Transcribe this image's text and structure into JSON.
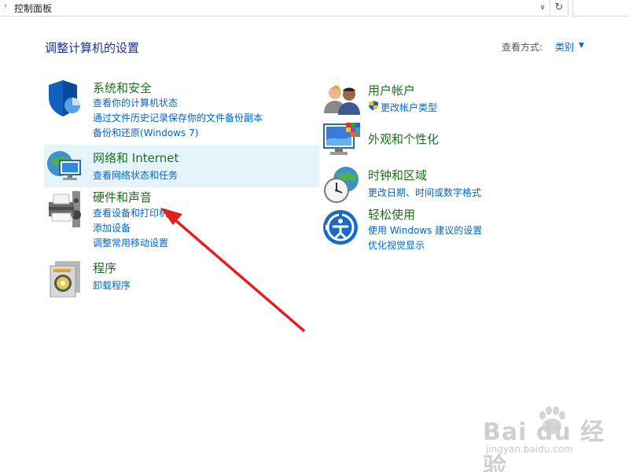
{
  "address_bar": {
    "path": "控制面板",
    "chevron_icon": "chevron-right-icon",
    "dropdown_icon": "chevron-down-icon",
    "refresh_icon": "refresh-icon"
  },
  "header": {
    "title": "调整计算机的设置",
    "view_label": "查看方式:",
    "view_value": "类别"
  },
  "categories": [
    {
      "title": "系统和安全",
      "icon": "security-shield-icon",
      "links": [
        "查看你的计算机状态",
        "通过文件历史记录保存你的文件备份副本",
        "备份和还原(Windows 7)"
      ]
    },
    {
      "title": "网络和 Internet",
      "icon": "network-globe-icon",
      "links": [
        "查看网络状态和任务"
      ]
    },
    {
      "title": "硬件和声音",
      "icon": "printer-speaker-icon",
      "links": [
        "查看设备和打印机",
        "添加设备",
        "调整常用移动设置"
      ]
    },
    {
      "title": "程序",
      "icon": "programs-disc-icon",
      "links": [
        "卸载程序"
      ]
    },
    {
      "title": "用户帐户",
      "icon": "user-accounts-icon",
      "links": [
        "更改帐户类型"
      ]
    },
    {
      "title": "外观和个性化",
      "icon": "appearance-monitor-icon",
      "links": []
    },
    {
      "title": "时钟和区域",
      "icon": "clock-globe-icon",
      "links": [
        "更改日期、时间或数字格式"
      ]
    },
    {
      "title": "轻松使用",
      "icon": "ease-of-access-icon",
      "links": [
        "使用 Windows 建议的设置",
        "优化视觉显示"
      ]
    }
  ],
  "annotation": {
    "arrow_color": "#e02020"
  },
  "watermark": {
    "main": "Bai du 经验",
    "sub": "jingyan.baidu.com"
  },
  "colors": {
    "title_blue": "#1e3287",
    "category_green": "#1e6e1e",
    "link_blue": "#0066cc",
    "hover_bg": "#e5f3fb"
  }
}
